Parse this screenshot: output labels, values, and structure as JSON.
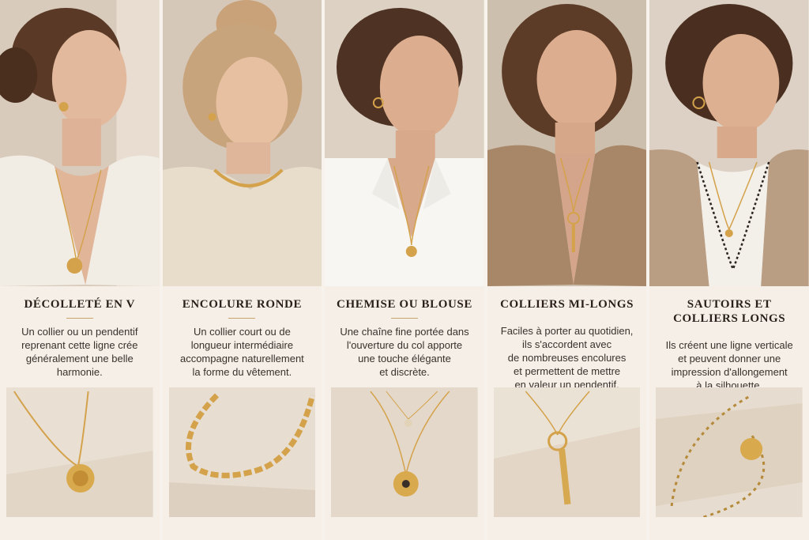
{
  "columns": [
    {
      "title": "Décolleté en V",
      "description": "Un collier ou un pendentif\nreprenant cette ligne crée\ngénéralement une belle\nharmonie."
    },
    {
      "title": "Encolure ronde",
      "description": "Un collier court ou de\nlongueur intermédiaire\naccompagne naturellement\nla forme du vêtement."
    },
    {
      "title": "Chemise ou blouse",
      "description": "Une chaîne fine portée dans\nl'ouverture du col apporte\nune touche élégante\net discrète."
    },
    {
      "title": "Colliers mi-longs",
      "description": "Faciles à porter au quotidien,\nils s'accordent avec\nde nombreuses encolures\net permettent de mettre\nen valeur un pendentif."
    },
    {
      "title": "Sautoirs et\ncolliers longs",
      "description": "Ils créent une ligne verticale\net peuvent donner une\nimpression d'allongement\nà la silhouette."
    }
  ],
  "colors": {
    "background": "#f3ede6",
    "accent_rule": "#c9a46a",
    "gold": "#d4a24a",
    "stone": "#e6dccf"
  }
}
